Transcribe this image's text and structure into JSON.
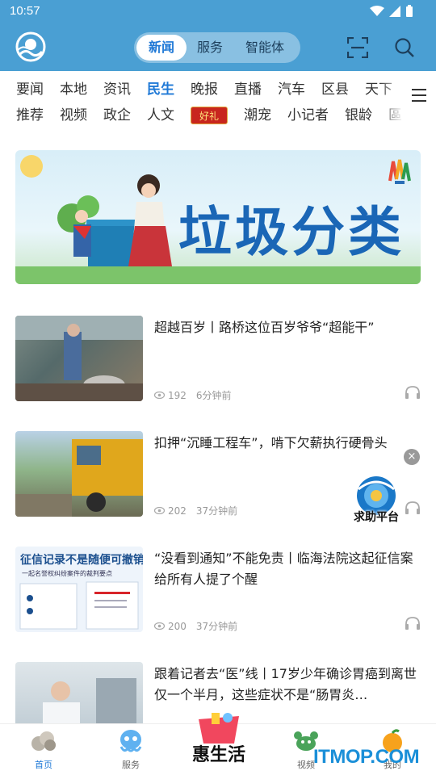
{
  "status_bar": {
    "time": "10:57"
  },
  "header": {
    "tabs": [
      {
        "label": "新闻",
        "active": true
      },
      {
        "label": "服务",
        "active": false
      },
      {
        "label": "智能体",
        "active": false
      }
    ],
    "colors": {
      "header_bg": "#4a9fd3",
      "accent": "#1e78d6"
    }
  },
  "channels": {
    "row1": [
      "要闻",
      "本地",
      "资讯",
      "民生",
      "晚报",
      "直播",
      "汽车",
      "区县",
      "天下"
    ],
    "row2": [
      "推荐",
      "视频",
      "政企",
      "人文",
      "好礼",
      "潮宠",
      "小记者",
      "银龄",
      "區"
    ],
    "active": "民生"
  },
  "banner": {
    "title": "垃圾分类"
  },
  "news": [
    {
      "title": "超越百岁丨路桥这位百岁爷爷“超能干”",
      "views": "192",
      "time": "6分钟前"
    },
    {
      "title": "扣押“沉睡工程车”，啃下欠薪执行硬骨头",
      "views": "202",
      "time": "37分钟前"
    },
    {
      "title": "“没看到通知”不能免责丨临海法院这起征信案给所有人提了个醒",
      "views": "200",
      "time": "37分钟前",
      "thumb_text": "征信记录不是随便可撤销",
      "thumb_sub": "一起名誉权纠纷案件的裁判要点"
    },
    {
      "title": "跟着记者去“医”线丨17岁少年确诊胃癌到离世仅一个半月，这些症状不是“肠胃炎…"
    }
  ],
  "float_ad": {
    "label": "求助平台"
  },
  "bottom_nav": [
    {
      "label": "首页",
      "active": true
    },
    {
      "label": "服务",
      "active": false
    },
    {
      "label": "惠生活",
      "active": false
    },
    {
      "label": "视频",
      "active": false
    },
    {
      "label": "我的",
      "active": false
    }
  ],
  "watermark": "ITMOP.COM"
}
